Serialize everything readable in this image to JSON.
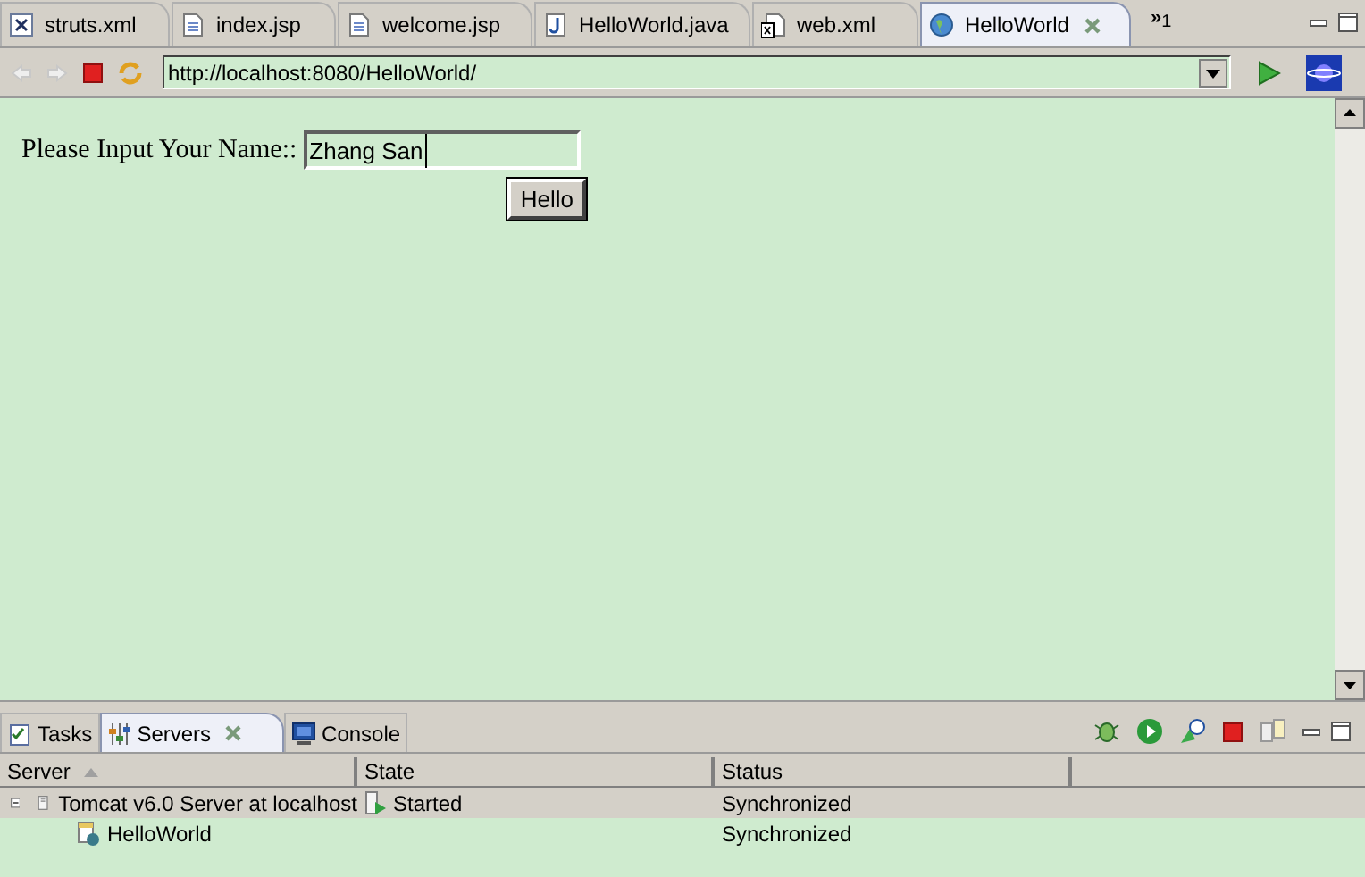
{
  "editor_tabs": [
    {
      "label": "struts.xml",
      "kind": "xml",
      "selected": false
    },
    {
      "label": "index.jsp",
      "kind": "jsp",
      "selected": false
    },
    {
      "label": "welcome.jsp",
      "kind": "jsp",
      "selected": false
    },
    {
      "label": "HelloWorld.java",
      "kind": "java",
      "selected": false
    },
    {
      "label": "web.xml",
      "kind": "webxml",
      "selected": false
    },
    {
      "label": "HelloWorld",
      "kind": "browser",
      "selected": true
    }
  ],
  "overflow": {
    "label": "»",
    "count": "1"
  },
  "browser": {
    "url": "http://localhost:8080/HelloWorld/",
    "page": {
      "label": "Please Input Your Name::",
      "value": "Zhang San",
      "button": "Hello"
    }
  },
  "panel_tabs": [
    {
      "label": "Tasks",
      "kind": "tasks",
      "selected": false
    },
    {
      "label": "Servers",
      "kind": "servers",
      "selected": true
    },
    {
      "label": "Console",
      "kind": "console",
      "selected": false
    }
  ],
  "table": {
    "columns": [
      "Server",
      "State",
      "Status"
    ],
    "rows": [
      {
        "server": "Tomcat v6.0 Server at localhost",
        "state": "Started",
        "status": "Synchronized",
        "expanded": true,
        "selected": true,
        "children": [
          {
            "server": "HelloWorld",
            "status": "Synchronized",
            "selected": false
          }
        ]
      }
    ]
  }
}
